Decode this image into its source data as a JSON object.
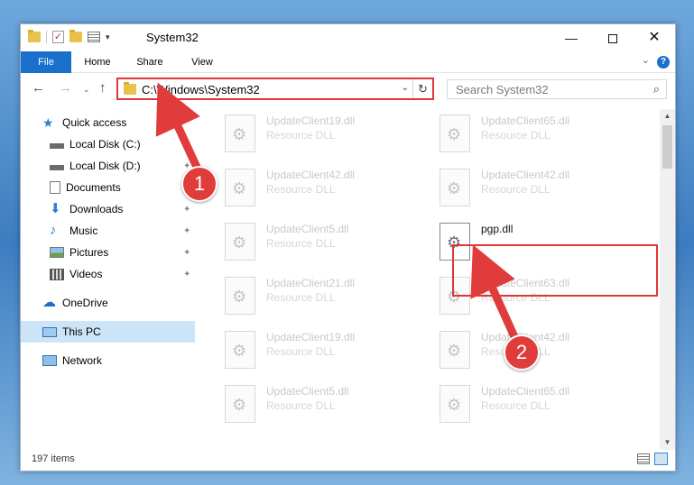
{
  "window": {
    "title": "System32"
  },
  "ribbon": {
    "tabs": [
      "File",
      "Home",
      "Share",
      "View"
    ]
  },
  "navigation": {
    "address": "C:\\Windows\\System32",
    "search_placeholder": "Search System32"
  },
  "sidebar": {
    "items": [
      {
        "label": "Quick access",
        "icon": "star-icon"
      },
      {
        "label": "Local Disk (C:)",
        "icon": "drive-icon",
        "pinned": true
      },
      {
        "label": "Local Disk (D:)",
        "icon": "drive-icon",
        "pinned": true
      },
      {
        "label": "Documents",
        "icon": "documents-icon",
        "pinned": true
      },
      {
        "label": "Downloads",
        "icon": "download-icon",
        "pinned": true
      },
      {
        "label": "Music",
        "icon": "music-icon",
        "pinned": true
      },
      {
        "label": "Pictures",
        "icon": "pictures-icon",
        "pinned": true
      },
      {
        "label": "Videos",
        "icon": "videos-icon",
        "pinned": true
      },
      {
        "label": "OneDrive",
        "icon": "cloud-icon"
      },
      {
        "label": "This PC",
        "icon": "computer-icon",
        "selected": true
      },
      {
        "label": "Network",
        "icon": "network-icon"
      }
    ]
  },
  "files": [
    {
      "name": "UpdateClient19.dll",
      "type": "Resource DLL"
    },
    {
      "name": "UpdateClient65.dll",
      "type": "Resource DLL"
    },
    {
      "name": "UpdateClient42.dll",
      "type": "Resource DLL"
    },
    {
      "name": "UpdateClient42.dll",
      "type": "Resource DLL"
    },
    {
      "name": "UpdateClient5.dll",
      "type": "Resource DLL"
    },
    {
      "name": "pgp.dll",
      "type": "",
      "active": true
    },
    {
      "name": "UpdateClient21.dll",
      "type": "Resource DLL"
    },
    {
      "name": "UpdateClient63.dll",
      "type": "Resource DLL"
    },
    {
      "name": "UpdateClient19.dll",
      "type": "Resource DLL"
    },
    {
      "name": "UpdateClient42.dll",
      "type": "Resource DLL"
    },
    {
      "name": "UpdateClient5.dll",
      "type": "Resource DLL"
    },
    {
      "name": "UpdateClient65.dll",
      "type": "Resource DLL"
    }
  ],
  "status": {
    "item_count": "197 items"
  },
  "annotations": {
    "callout_1": "1",
    "callout_2": "2"
  },
  "colors": {
    "accent": "#1a6fcb",
    "highlight": "#e03636",
    "selected": "#cce4f7"
  }
}
